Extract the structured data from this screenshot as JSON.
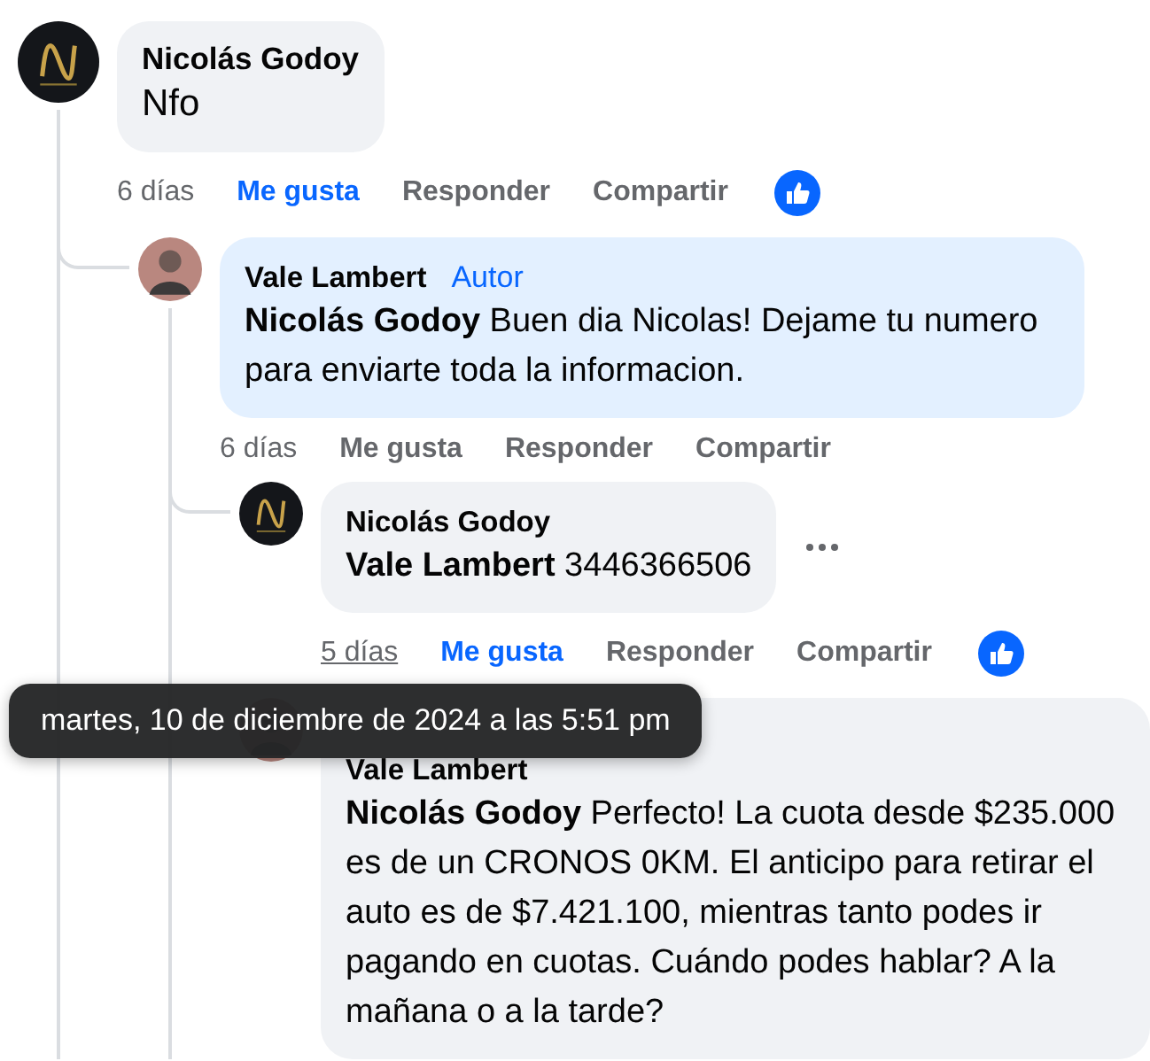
{
  "comments": [
    {
      "author": "Nicolás Godoy",
      "avatar": {
        "kind": "logo"
      },
      "highlighted": false,
      "text": "Nfo",
      "time": "6 días",
      "time_hovered": false,
      "like": "Me gusta",
      "liked": true,
      "reply": "Responder",
      "share": "Compartir",
      "reacted": true,
      "options_shown": false,
      "children": [
        {
          "author": "Vale Lambert",
          "badge": "Autor",
          "avatar": {
            "kind": "photo"
          },
          "highlighted": true,
          "text": "**Nicolás Godoy** Buen dia Nicolas! Dejame tu numero para enviarte toda la informacion.",
          "time": "6 días",
          "time_hovered": false,
          "like": "Me gusta",
          "liked": false,
          "reply": "Responder",
          "share": "Compartir",
          "reacted": false,
          "options_shown": false,
          "children": [
            {
              "author": "Nicolás Godoy",
              "avatar": {
                "kind": "logo"
              },
              "highlighted": false,
              "text": "**Vale Lambert** 3446366506",
              "time": "5 días",
              "time_hovered": true,
              "like": "Me gusta",
              "liked": true,
              "reply": "Responder",
              "share": "Compartir",
              "reacted": true,
              "options_shown": true
            },
            {
              "author": "Vale Lambert",
              "avatar": {
                "kind": "photo"
              },
              "highlighted": false,
              "text": "**Nicolás Godoy** Perfecto! La cuota desde $235.000 es de un CRONOS 0KM. El anticipo para retirar el auto es de $7.421.100, mientras tanto podes ir pagando en cuotas. Cuándo podes hablar? A la mañana o a la tarde?",
              "options_shown": false
            }
          ]
        }
      ]
    }
  ],
  "tooltip": {
    "text": "martes, 10 de diciembre de 2024 a las 5:51 pm"
  }
}
